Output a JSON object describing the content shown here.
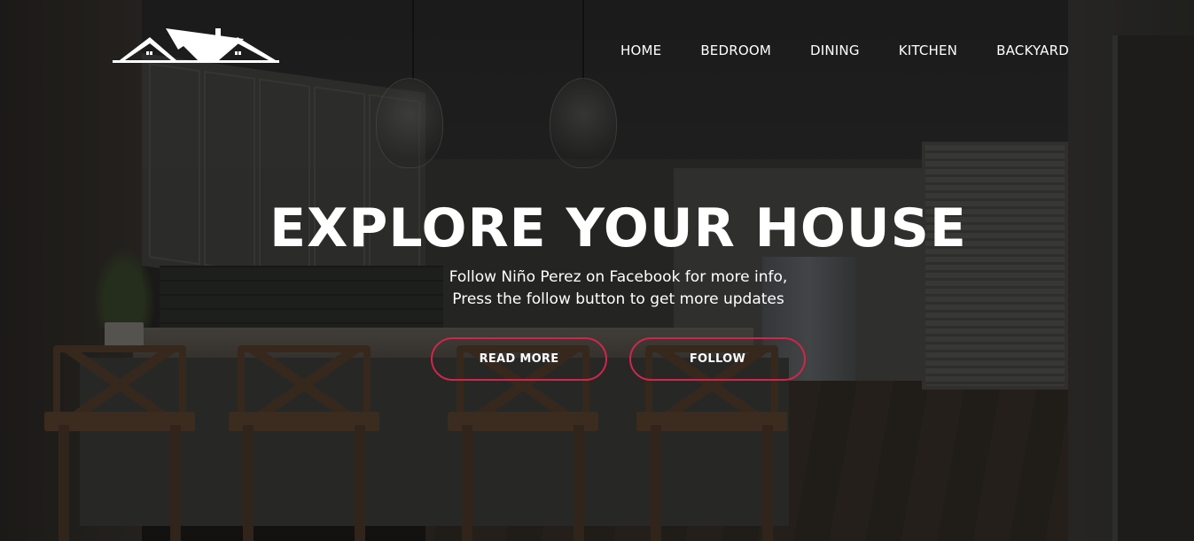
{
  "header": {
    "logo_icon": "house-roofs-logo-icon",
    "nav": [
      {
        "label": "HOME"
      },
      {
        "label": "BEDROOM"
      },
      {
        "label": "DINING"
      },
      {
        "label": "KITCHEN"
      },
      {
        "label": "BACKYARD"
      }
    ]
  },
  "hero": {
    "headline": "EXPLORE YOUR HOUSE",
    "subtitle_line1": "Follow Niño Perez on Facebook for more info,",
    "subtitle_line2": "Press the follow button to get more updates",
    "read_more_label": "READ MORE",
    "follow_label": "FOLLOW"
  },
  "colors": {
    "accent_border": "#d4244b",
    "text": "#ffffff",
    "overlay": "rgba(0,0,0,0.38)"
  }
}
